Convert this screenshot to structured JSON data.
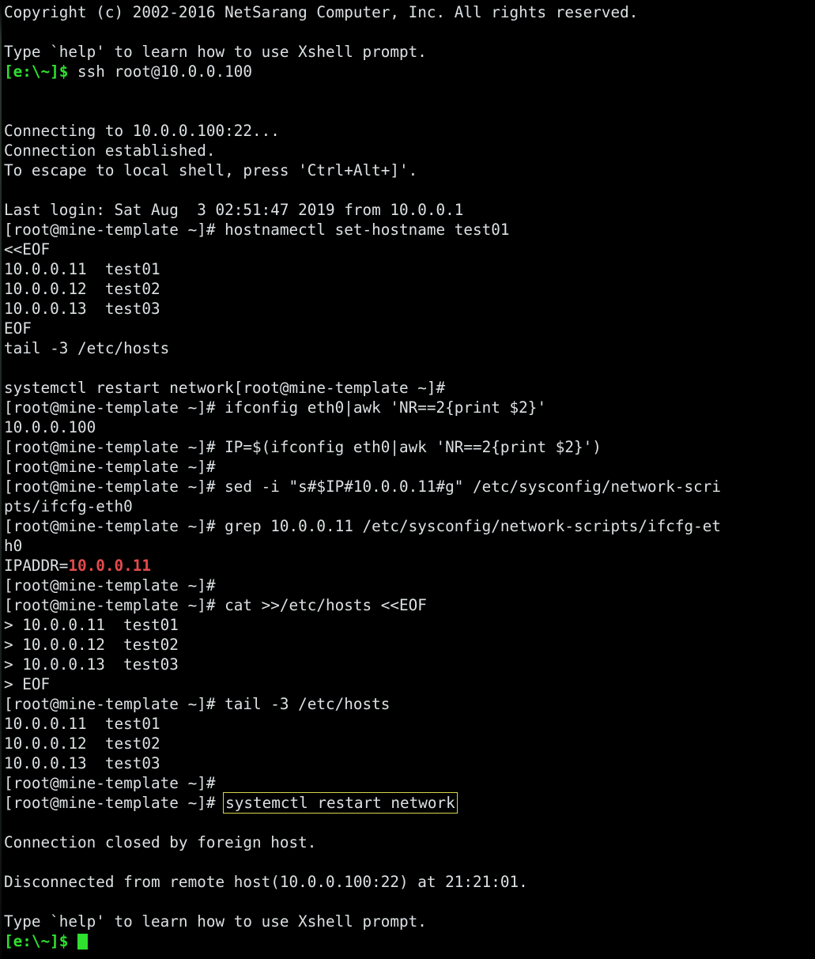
{
  "terminal": {
    "app": "Xshell",
    "colors": {
      "background": "#000000",
      "foreground": "#dce1e3",
      "prompt_green": "#2fe02f",
      "highlight_red": "#e34b4b",
      "box_border_yellow": "#d6d64a"
    },
    "cursor": {
      "shape": "block",
      "color": "#2fe02f"
    },
    "local_prompt": "[e:\\~]$",
    "remote_prompt": "[root@mine-template ~]#",
    "lines": [
      {
        "id": 0,
        "segments": [
          {
            "style": "default",
            "text": "Copyright (c) 2002-2016 NetSarang Computer, Inc. All rights reserved."
          }
        ]
      },
      {
        "id": 1,
        "segments": [
          {
            "style": "default",
            "text": ""
          }
        ]
      },
      {
        "id": 2,
        "segments": [
          {
            "style": "default",
            "text": "Type `help' to learn how to use Xshell prompt."
          }
        ]
      },
      {
        "id": 3,
        "segments": [
          {
            "style": "prompt",
            "text": "[e:\\~]$"
          },
          {
            "style": "default",
            "text": " ssh root@10.0.0.100"
          }
        ]
      },
      {
        "id": 4,
        "segments": [
          {
            "style": "default",
            "text": ""
          }
        ]
      },
      {
        "id": 5,
        "segments": [
          {
            "style": "default",
            "text": ""
          }
        ]
      },
      {
        "id": 6,
        "segments": [
          {
            "style": "default",
            "text": "Connecting to 10.0.0.100:22..."
          }
        ]
      },
      {
        "id": 7,
        "segments": [
          {
            "style": "default",
            "text": "Connection established."
          }
        ]
      },
      {
        "id": 8,
        "segments": [
          {
            "style": "default",
            "text": "To escape to local shell, press 'Ctrl+Alt+]'."
          }
        ]
      },
      {
        "id": 9,
        "segments": [
          {
            "style": "default",
            "text": ""
          }
        ]
      },
      {
        "id": 10,
        "segments": [
          {
            "style": "default",
            "text": "Last login: Sat Aug  3 02:51:47 2019 from 10.0.0.1"
          }
        ]
      },
      {
        "id": 11,
        "segments": [
          {
            "style": "default",
            "text": "[root@mine-template ~]# hostnamectl set-hostname test01"
          }
        ]
      },
      {
        "id": 12,
        "segments": [
          {
            "style": "default",
            "text": "<<EOF"
          }
        ]
      },
      {
        "id": 13,
        "segments": [
          {
            "style": "default",
            "text": "10.0.0.11  test01"
          }
        ]
      },
      {
        "id": 14,
        "segments": [
          {
            "style": "default",
            "text": "10.0.0.12  test02"
          }
        ]
      },
      {
        "id": 15,
        "segments": [
          {
            "style": "default",
            "text": "10.0.0.13  test03"
          }
        ]
      },
      {
        "id": 16,
        "segments": [
          {
            "style": "default",
            "text": "EOF"
          }
        ]
      },
      {
        "id": 17,
        "segments": [
          {
            "style": "default",
            "text": "tail -3 /etc/hosts"
          }
        ]
      },
      {
        "id": 18,
        "segments": [
          {
            "style": "default",
            "text": ""
          }
        ]
      },
      {
        "id": 19,
        "segments": [
          {
            "style": "default",
            "text": "systemctl restart network[root@mine-template ~]#"
          }
        ]
      },
      {
        "id": 20,
        "segments": [
          {
            "style": "default",
            "text": "[root@mine-template ~]# ifconfig eth0|awk 'NR==2{print $2}'"
          }
        ]
      },
      {
        "id": 21,
        "segments": [
          {
            "style": "default",
            "text": "10.0.0.100"
          }
        ]
      },
      {
        "id": 22,
        "segments": [
          {
            "style": "default",
            "text": "[root@mine-template ~]# IP=$(ifconfig eth0|awk 'NR==2{print $2}')"
          }
        ]
      },
      {
        "id": 23,
        "segments": [
          {
            "style": "default",
            "text": "[root@mine-template ~]#"
          }
        ]
      },
      {
        "id": 24,
        "segments": [
          {
            "style": "default",
            "text": "[root@mine-template ~]# sed -i \"s#$IP#10.0.0.11#g\" /etc/sysconfig/network-scri"
          }
        ]
      },
      {
        "id": 25,
        "segments": [
          {
            "style": "default",
            "text": "pts/ifcfg-eth0"
          }
        ]
      },
      {
        "id": 26,
        "segments": [
          {
            "style": "default",
            "text": "[root@mine-template ~]# grep 10.0.0.11 /etc/sysconfig/network-scripts/ifcfg-et"
          }
        ]
      },
      {
        "id": 27,
        "segments": [
          {
            "style": "default",
            "text": "h0"
          }
        ]
      },
      {
        "id": 28,
        "segments": [
          {
            "style": "default",
            "text": "IPADDR="
          },
          {
            "style": "red",
            "text": "10.0.0.11"
          }
        ]
      },
      {
        "id": 29,
        "segments": [
          {
            "style": "default",
            "text": "[root@mine-template ~]#"
          }
        ]
      },
      {
        "id": 30,
        "segments": [
          {
            "style": "default",
            "text": "[root@mine-template ~]# cat >>/etc/hosts <<EOF"
          }
        ]
      },
      {
        "id": 31,
        "segments": [
          {
            "style": "default",
            "text": "> 10.0.0.11  test01"
          }
        ]
      },
      {
        "id": 32,
        "segments": [
          {
            "style": "default",
            "text": "> 10.0.0.12  test02"
          }
        ]
      },
      {
        "id": 33,
        "segments": [
          {
            "style": "default",
            "text": "> 10.0.0.13  test03"
          }
        ]
      },
      {
        "id": 34,
        "segments": [
          {
            "style": "default",
            "text": "> EOF"
          }
        ]
      },
      {
        "id": 35,
        "segments": [
          {
            "style": "default",
            "text": "[root@mine-template ~]# tail -3 /etc/hosts"
          }
        ]
      },
      {
        "id": 36,
        "segments": [
          {
            "style": "default",
            "text": "10.0.0.11  test01"
          }
        ]
      },
      {
        "id": 37,
        "segments": [
          {
            "style": "default",
            "text": "10.0.0.12  test02"
          }
        ]
      },
      {
        "id": 38,
        "segments": [
          {
            "style": "default",
            "text": "10.0.0.13  test03"
          }
        ]
      },
      {
        "id": 39,
        "segments": [
          {
            "style": "default",
            "text": "[root@mine-template ~]#"
          }
        ]
      },
      {
        "id": 40,
        "segments": [
          {
            "style": "default",
            "text": "[root@mine-template ~]# "
          },
          {
            "style": "boxed",
            "text": "systemctl restart network"
          }
        ]
      },
      {
        "id": 41,
        "segments": [
          {
            "style": "default",
            "text": ""
          }
        ]
      },
      {
        "id": 42,
        "segments": [
          {
            "style": "default",
            "text": "Connection closed by foreign host."
          }
        ]
      },
      {
        "id": 43,
        "segments": [
          {
            "style": "default",
            "text": ""
          }
        ]
      },
      {
        "id": 44,
        "segments": [
          {
            "style": "default",
            "text": "Disconnected from remote host(10.0.0.100:22) at 21:21:01."
          }
        ]
      },
      {
        "id": 45,
        "segments": [
          {
            "style": "default",
            "text": ""
          }
        ]
      },
      {
        "id": 46,
        "segments": [
          {
            "style": "default",
            "text": "Type `help' to learn how to use Xshell prompt."
          }
        ]
      },
      {
        "id": 47,
        "segments": [
          {
            "style": "prompt",
            "text": "[e:\\~]$"
          },
          {
            "style": "default",
            "text": " "
          },
          {
            "style": "cursor",
            "text": ""
          }
        ]
      }
    ]
  }
}
